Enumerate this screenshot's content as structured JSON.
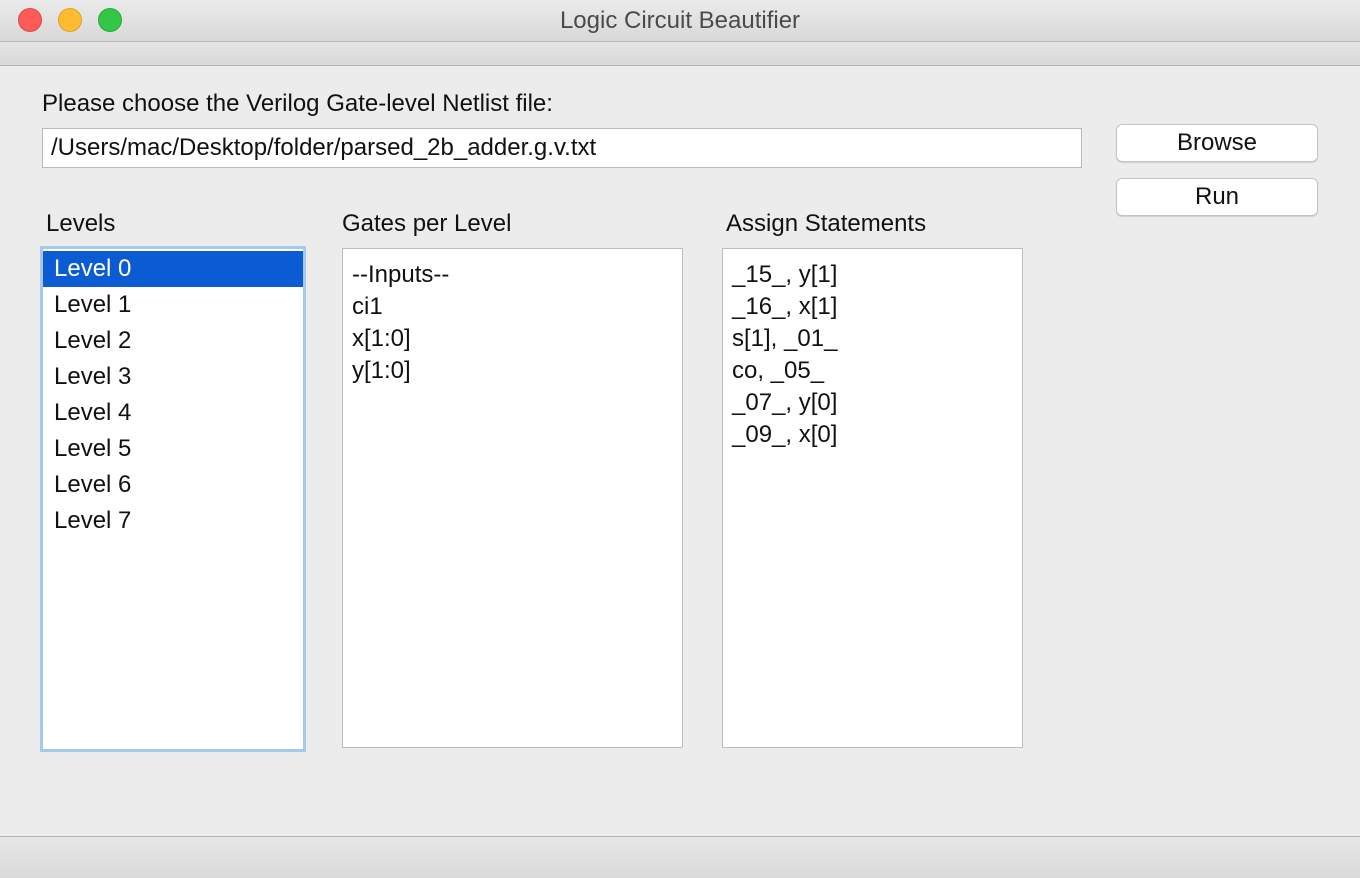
{
  "window": {
    "title": "Logic Circuit Beautifier"
  },
  "file_chooser": {
    "prompt": "Please choose the Verilog Gate-level Netlist file:",
    "path_value": "/Users/mac/Desktop/folder/parsed_2b_adder.g.v.txt",
    "browse_label": "Browse",
    "run_label": "Run"
  },
  "levels": {
    "label": "Levels",
    "selected_index": 0,
    "items": [
      "Level 0",
      "Level 1",
      "Level 2",
      "Level 3",
      "Level 4",
      "Level 5",
      "Level 6",
      "Level 7"
    ]
  },
  "gates_per_level": {
    "label": "Gates per Level",
    "items": [
      "--Inputs--",
      "ci1",
      "x[1:0]",
      "y[1:0]"
    ]
  },
  "assign_statements": {
    "label": "Assign Statements",
    "items": [
      "_15_, y[1]",
      "_16_, x[1]",
      "s[1], _01_",
      "co, _05_",
      "_07_, y[0]",
      "_09_, x[0]"
    ]
  },
  "colors": {
    "selection": "#0b5bd3",
    "focus_ring": "#a6c8ea",
    "window_bg": "#ececec"
  }
}
